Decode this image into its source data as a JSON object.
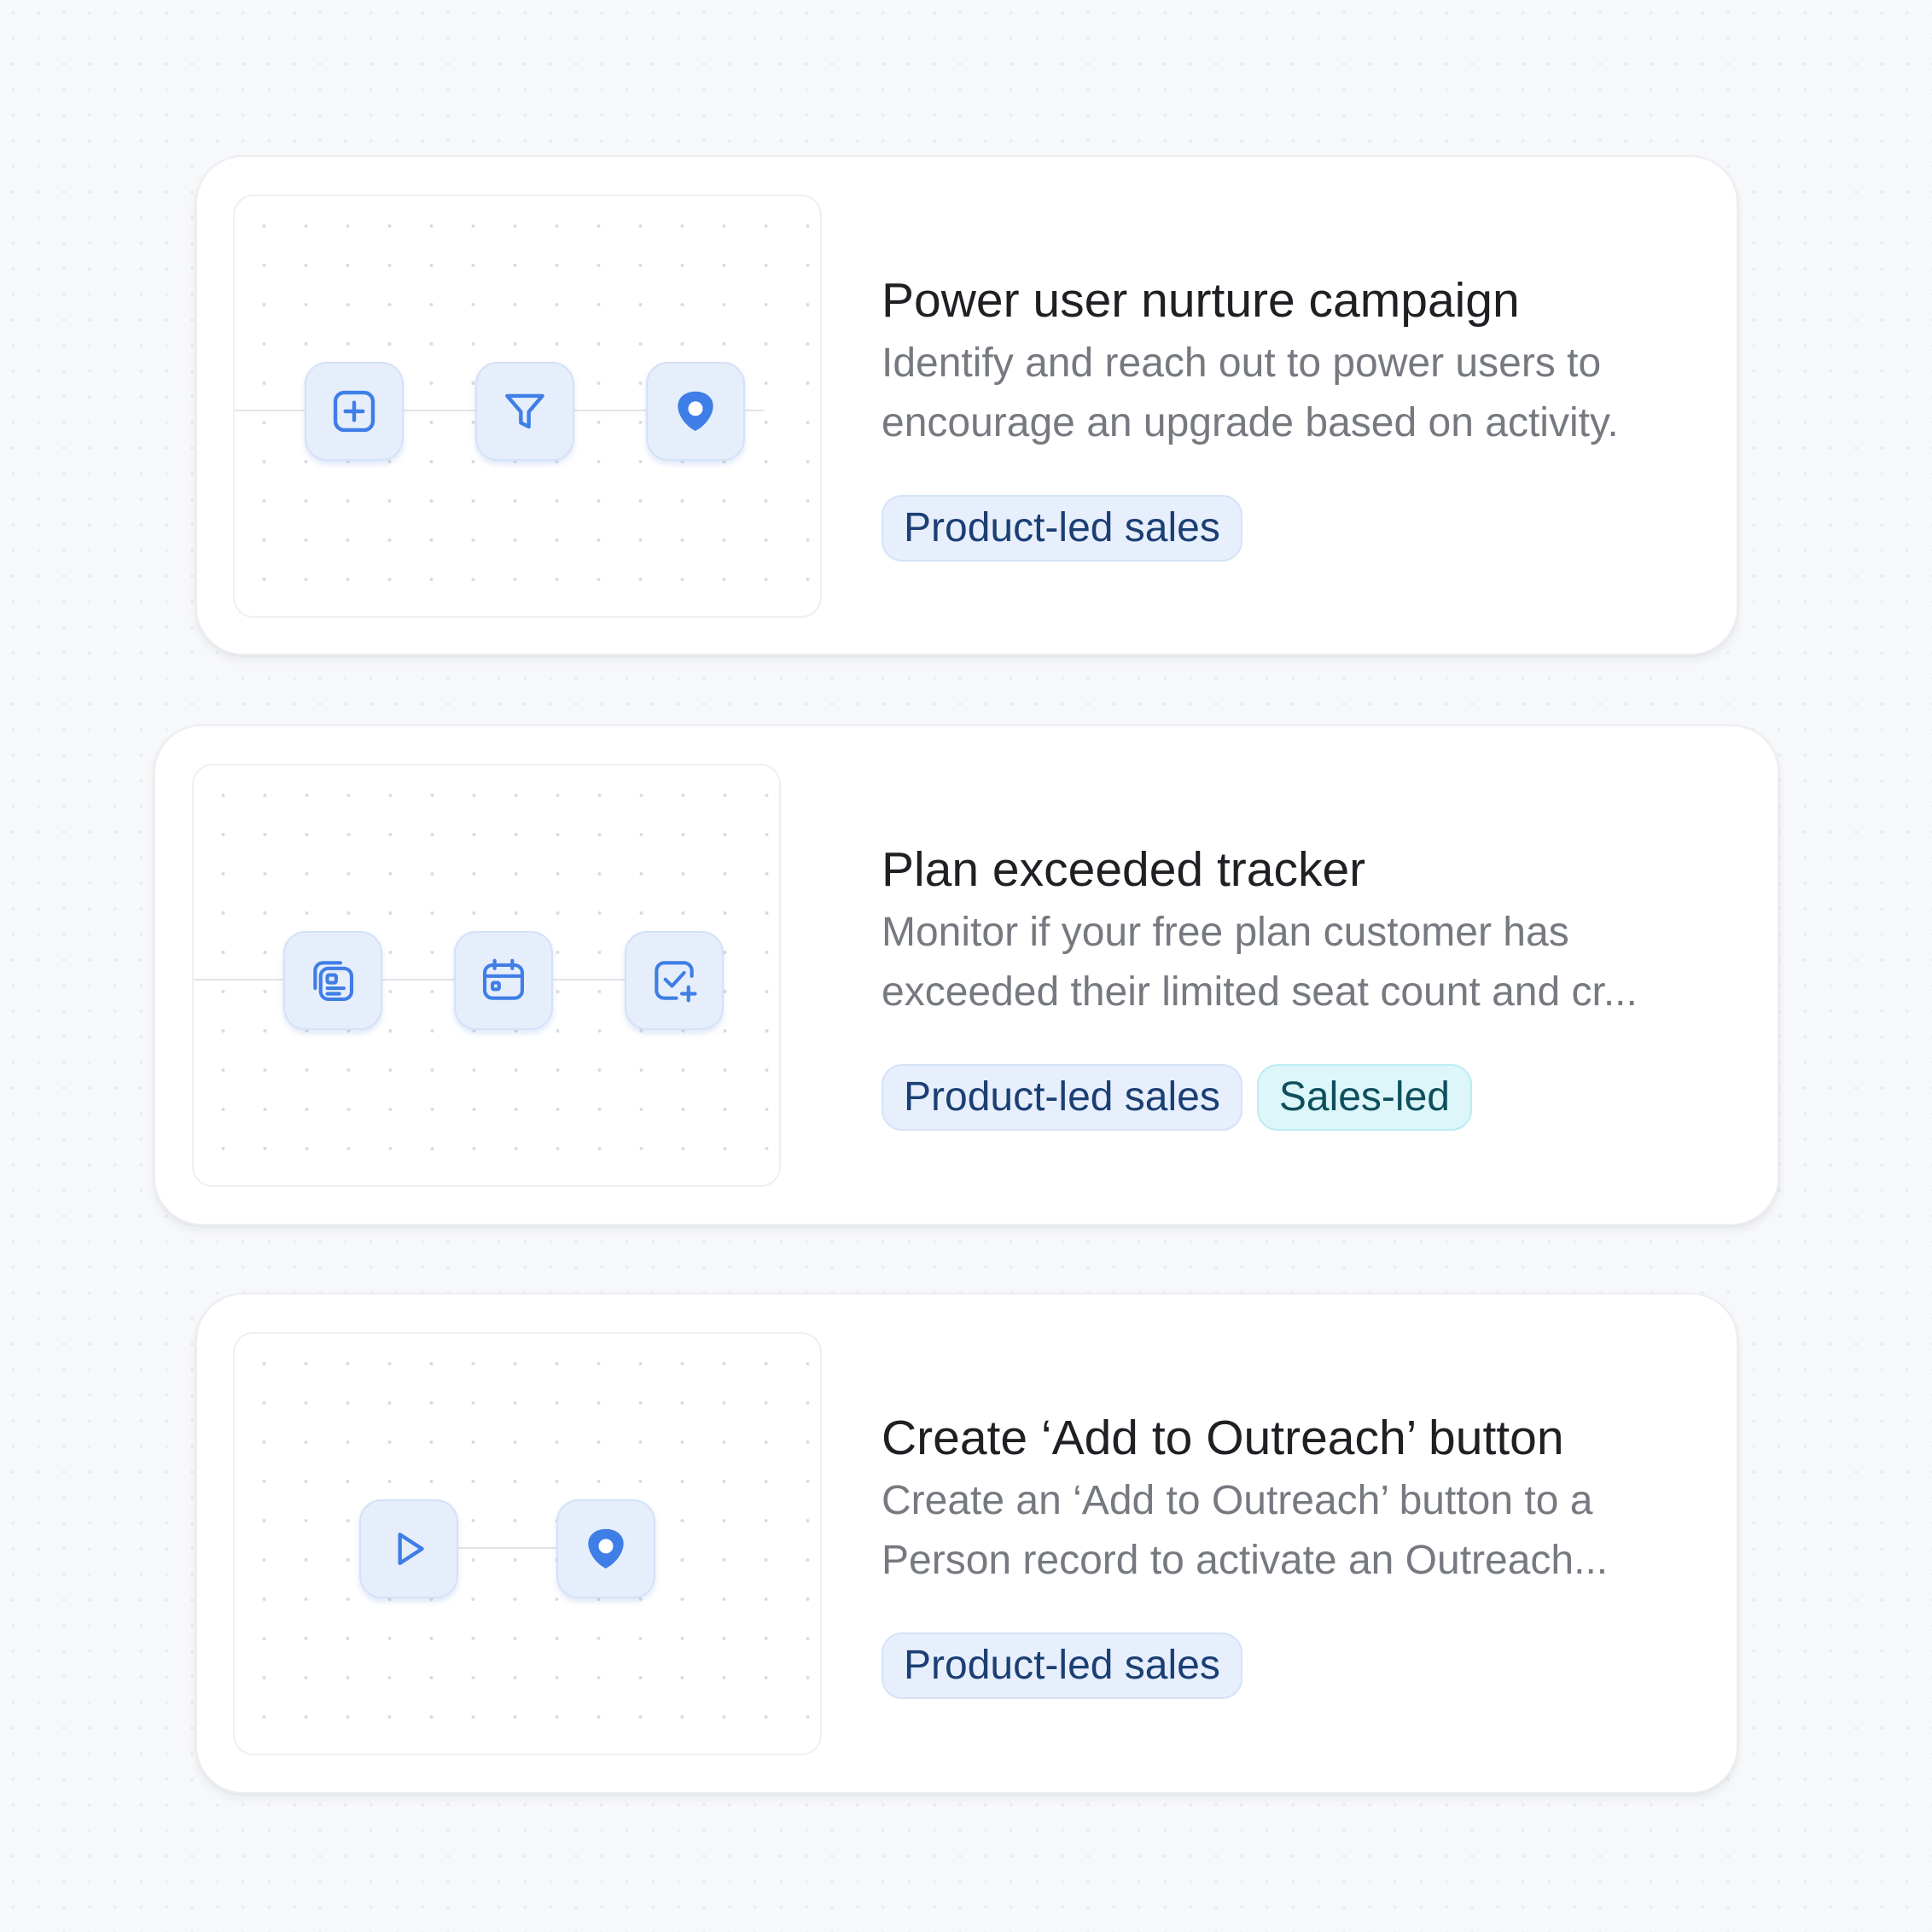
{
  "theme": {
    "icon_color": "#3f7ee6",
    "tag_blue_text": "#1b3f74",
    "tag_teal_text": "#0e4f5c"
  },
  "cards": [
    {
      "title": "Power user nurture campaign",
      "description_lines": [
        "Identify and reach out to power users to",
        "encourage an upgrade based on activity."
      ],
      "tags": [
        "Product-led sales"
      ],
      "flow_icons": [
        "plus-square-icon",
        "filter-icon",
        "outreach-logo-icon"
      ]
    },
    {
      "title": "Plan exceeded tracker",
      "description_lines": [
        "Monitor if your free plan customer has",
        "exceeded their limited seat count and cr..."
      ],
      "tags": [
        "Product-led sales",
        "Sales-led"
      ],
      "flow_icons": [
        "records-stack-icon",
        "calendar-icon",
        "task-add-icon"
      ]
    },
    {
      "title": "Create ‘Add to Outreach’ button",
      "description_lines": [
        "Create an ‘Add to Outreach’ button to a",
        "Person record to activate an Outreach..."
      ],
      "tags": [
        "Product-led sales"
      ],
      "flow_icons": [
        "play-icon",
        "outreach-logo-icon"
      ]
    }
  ]
}
